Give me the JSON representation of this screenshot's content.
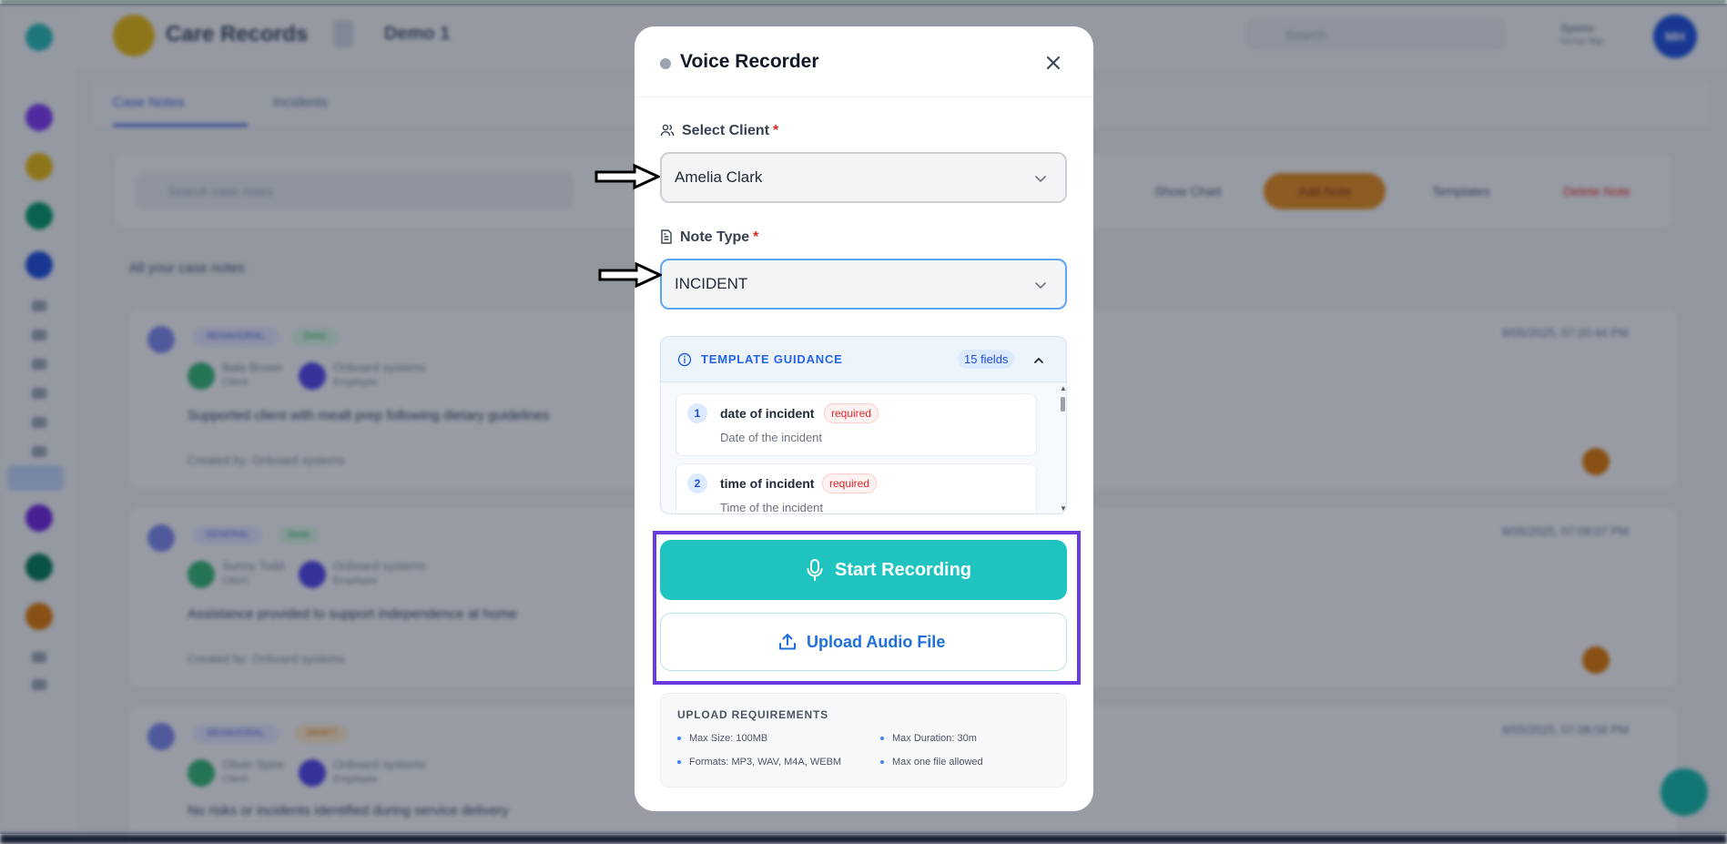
{
  "background": {
    "brand": "Care Records",
    "crumb": "Demo 1",
    "search_placeholder": "Search",
    "user_name": "Sysmo",
    "user_role": "Group Mgr",
    "avatar_initials": "MH",
    "tabs": [
      {
        "label": "Case Notes",
        "active": true
      },
      {
        "label": "Incidents",
        "active": false
      }
    ],
    "toolbar": {
      "search_placeholder": "Search case notes",
      "show_chart": "Show Chart",
      "add_note": "Add Note",
      "templates": "Templates",
      "delete_note": "Delete Note"
    },
    "list_title": "All your case notes",
    "cards": [
      {
        "type_badge": "BEHAVIORAL",
        "status_badge": "Done",
        "client": "Bala Brown",
        "client_sub": "Client",
        "author": "Onboard systems",
        "author_sub": "Employee",
        "text": "Supported client with mealt prep following dietary guidelines",
        "created_by": "Created by: Onboard systems",
        "date": "8/05/2025, 07:20:44 PM"
      },
      {
        "type_badge": "GENERAL",
        "status_badge": "Done",
        "client": "Sunny Todd",
        "client_sub": "Client",
        "author": "Onboard systems",
        "author_sub": "Employee",
        "text": "Assistance provided to support independence at home",
        "created_by": "Created by: Onboard systems",
        "date": "8/05/2025, 07:09:07 PM"
      },
      {
        "type_badge": "BEHAVIORAL",
        "status_badge": "DRAFT",
        "client": "Oliver Spire",
        "client_sub": "Client",
        "author": "Onboard systems",
        "author_sub": "Employee",
        "text": "No risks or incidents identified during service delivery",
        "created_by": "",
        "date": "8/05/2025, 07:08:58 PM"
      }
    ]
  },
  "modal": {
    "title": "Voice Recorder",
    "client_label": "Select Client",
    "client_required": "*",
    "client_value": "Amelia Clark",
    "note_type_label": "Note Type",
    "note_type_required": "*",
    "note_type_value": "INCIDENT",
    "guidance": {
      "title": "TEMPLATE GUIDANCE",
      "count": "15 fields",
      "items": [
        {
          "num": "1",
          "name": "date of incident",
          "badge": "required",
          "desc": "Date of the incident"
        },
        {
          "num": "2",
          "name": "time of incident",
          "badge": "required",
          "desc": "Time of the incident"
        }
      ]
    },
    "start_recording": "Start Recording",
    "upload_audio": "Upload Audio File",
    "requirements": {
      "title": "UPLOAD REQUIREMENTS",
      "max_size": "Max Size: 100MB",
      "max_duration": "Max Duration: 30m",
      "formats": "Formats: MP3, WAV, M4A, WEBM",
      "max_files": "Max one file allowed"
    }
  },
  "colors": {
    "primary_teal": "#1fc4c1",
    "link_blue": "#1d6fdc",
    "required_red": "#dc2626",
    "highlight_purple": "#6c3be0"
  }
}
